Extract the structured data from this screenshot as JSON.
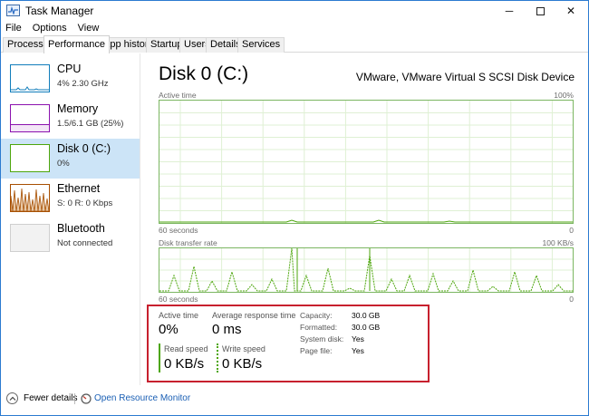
{
  "window": {
    "title": "Task Manager",
    "controls": {
      "minimize": "─",
      "close": "✕"
    }
  },
  "menu": [
    "File",
    "Options",
    "View"
  ],
  "tabs": [
    {
      "label": "Processes",
      "active": false
    },
    {
      "label": "Performance",
      "active": true
    },
    {
      "label": "App history",
      "active": false
    },
    {
      "label": "Startup",
      "active": false
    },
    {
      "label": "Users",
      "active": false
    },
    {
      "label": "Details",
      "active": false
    },
    {
      "label": "Services",
      "active": false
    }
  ],
  "sidebar": {
    "items": [
      {
        "title": "CPU",
        "subtitle": "4%  2.30 GHz",
        "color": "#117dbb"
      },
      {
        "title": "Memory",
        "subtitle": "1.5/6.1 GB (25%)",
        "color": "#8b12ae"
      },
      {
        "title": "Disk 0 (C:)",
        "subtitle": "0%",
        "color": "#4da60c",
        "selected": true
      },
      {
        "title": "Ethernet",
        "subtitle": "S: 0 R: 0 Kbps",
        "color": "#a74f01"
      },
      {
        "title": "Bluetooth",
        "subtitle": "Not connected",
        "color": "#bcbcbc"
      }
    ]
  },
  "main": {
    "title": "Disk 0 (C:)",
    "device": "VMware, VMware Virtual S SCSI Disk Device",
    "graph1": {
      "label": "Active time",
      "max": "100%",
      "time_label": "60 seconds",
      "min": "0"
    },
    "graph2": {
      "label": "Disk transfer rate",
      "max": "100 KB/s",
      "time_label": "60 seconds",
      "min": "0"
    },
    "stats": {
      "active_time_label": "Active time",
      "active_time_value": "0%",
      "avg_response_label": "Average response time",
      "avg_response_value": "0 ms",
      "read_label": "Read speed",
      "read_value": "0 KB/s",
      "write_label": "Write speed",
      "write_value": "0 KB/s"
    },
    "properties": [
      {
        "label": "Capacity:",
        "value": "30.0 GB"
      },
      {
        "label": "Formatted:",
        "value": "30.0 GB"
      },
      {
        "label": "System disk:",
        "value": "Yes"
      },
      {
        "label": "Page file:",
        "value": "Yes"
      }
    ],
    "graph_color": "#4da60c"
  },
  "footer": {
    "fewer_details": "Fewer details",
    "open_resource_monitor": "Open Resource Monitor"
  }
}
